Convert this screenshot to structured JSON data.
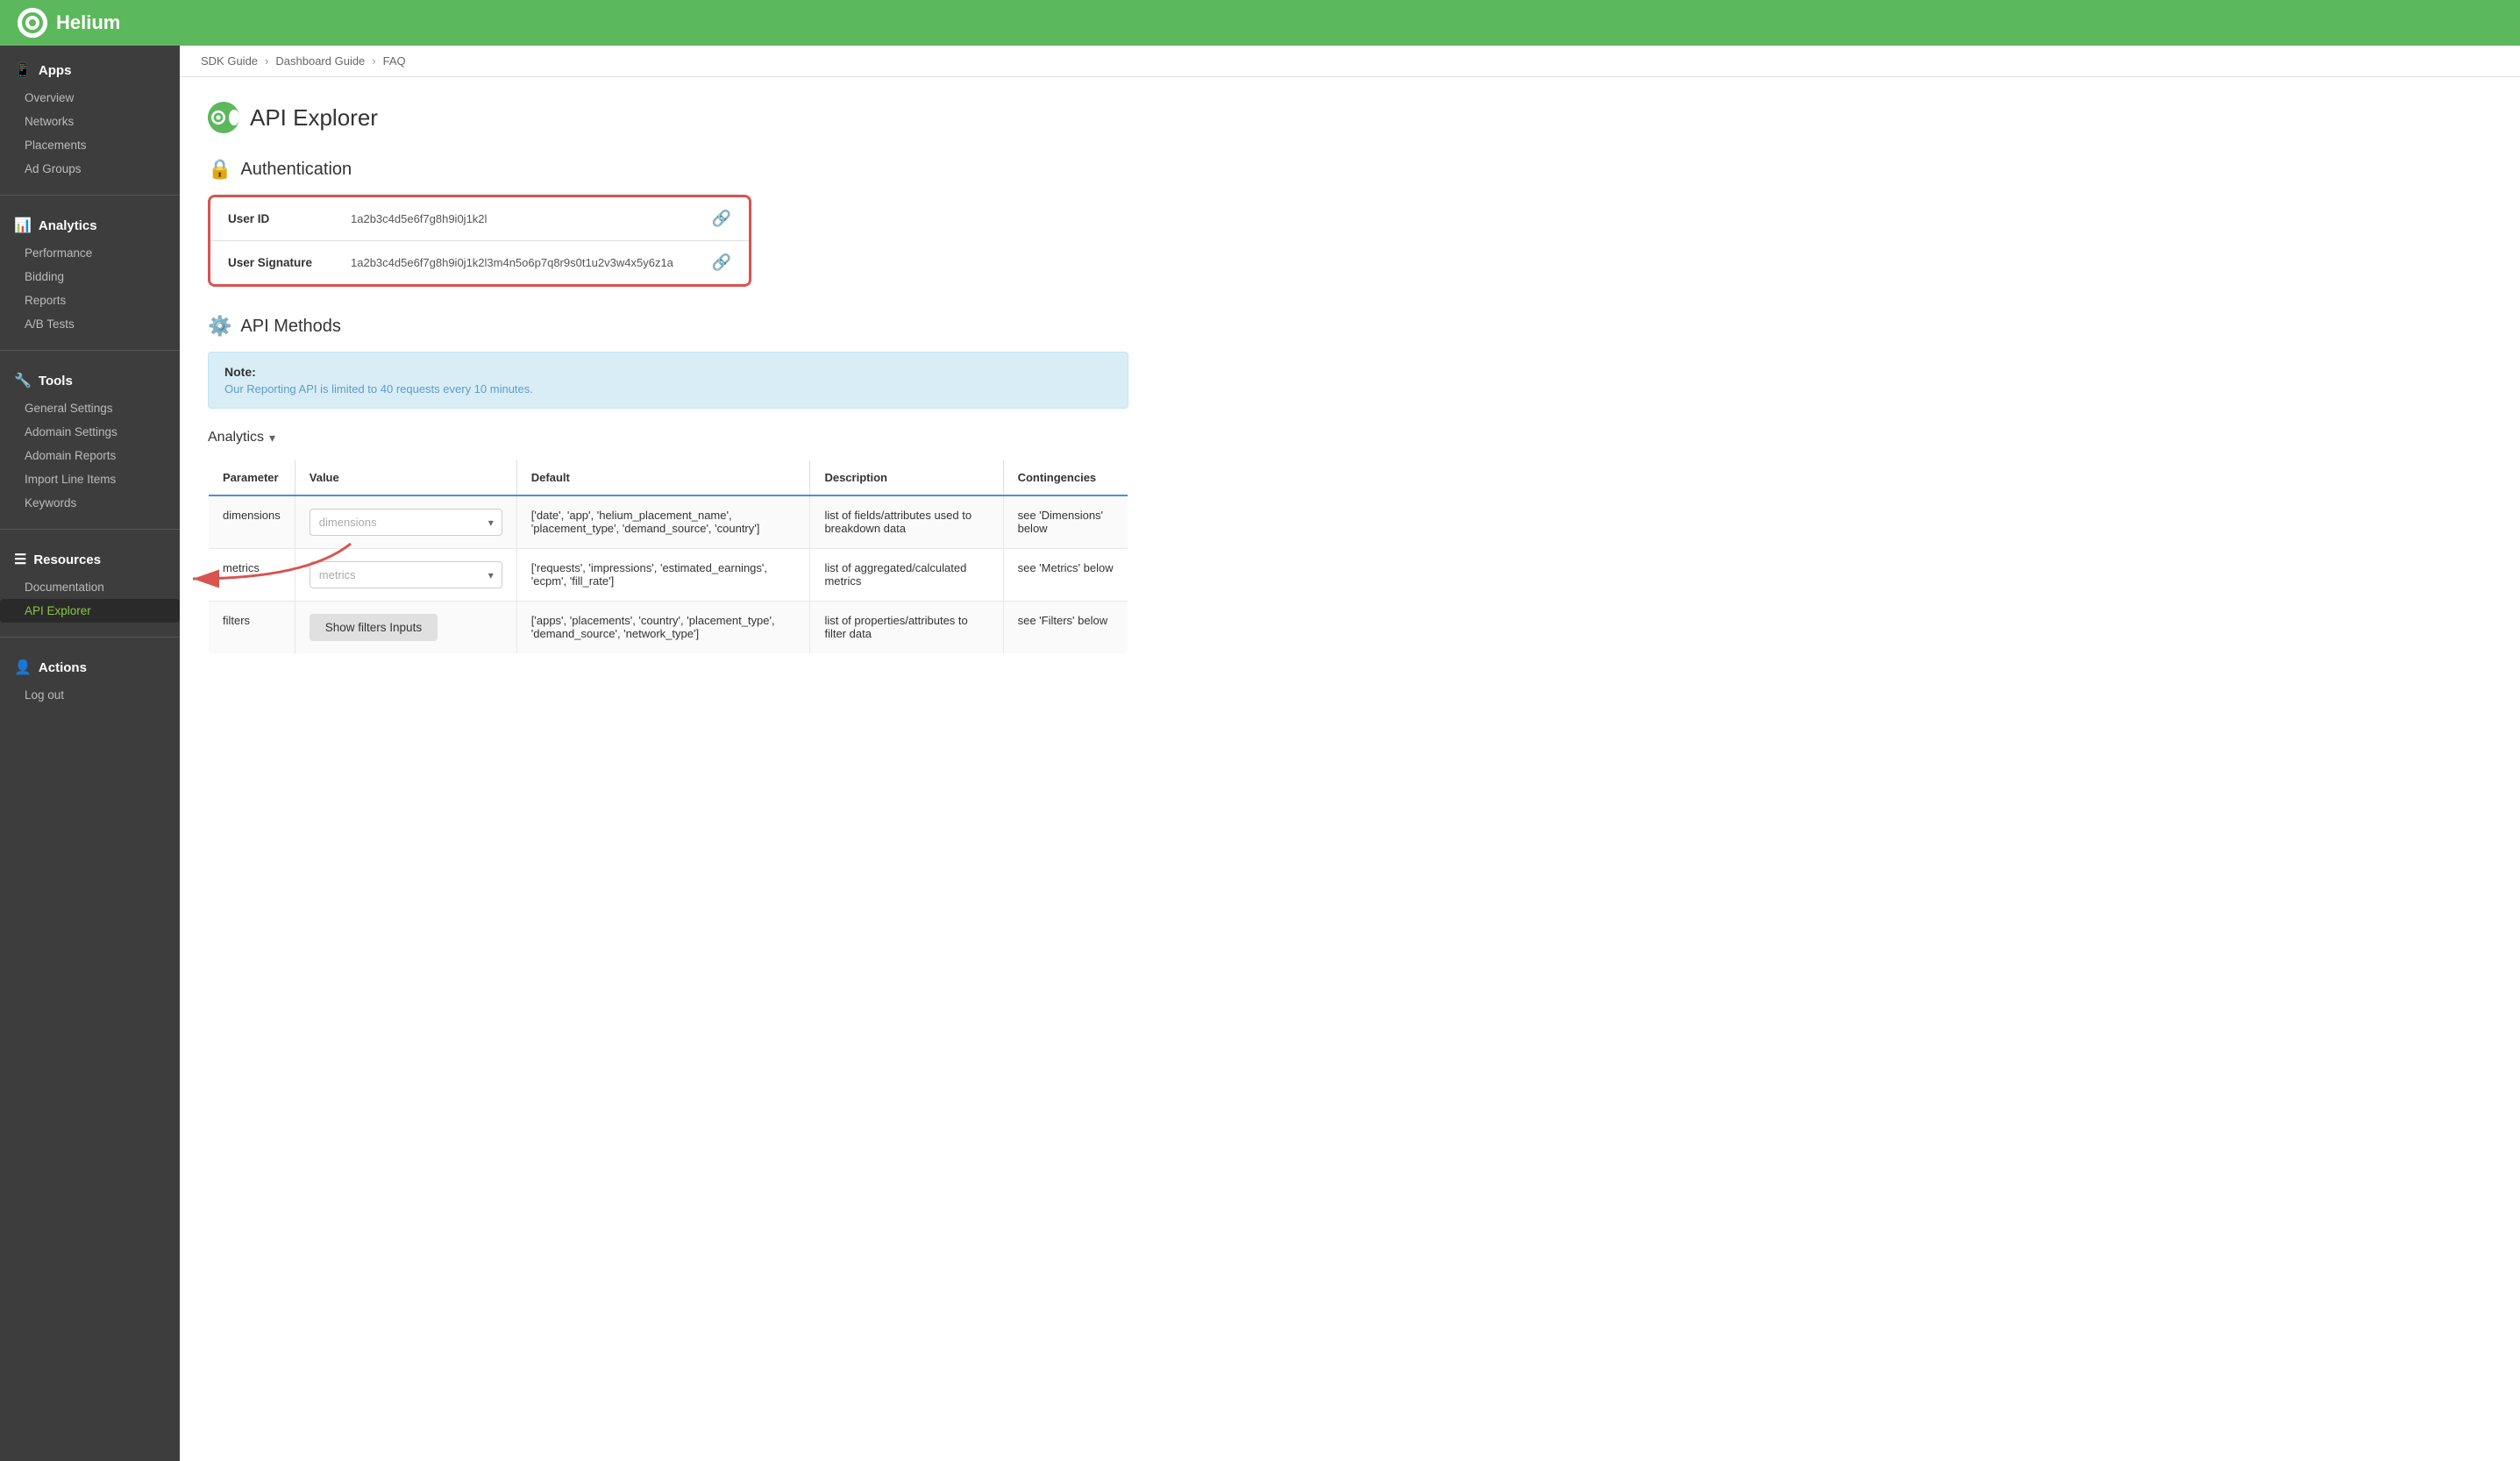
{
  "app": {
    "name": "Helium"
  },
  "breadcrumb": {
    "items": [
      "SDK Guide",
      "Dashboard Guide",
      "FAQ"
    ],
    "separators": [
      "›",
      "›"
    ]
  },
  "sidebar": {
    "sections": [
      {
        "id": "apps",
        "label": "Apps",
        "icon": "📱",
        "items": [
          "Overview",
          "Networks",
          "Placements",
          "Ad Groups"
        ]
      },
      {
        "id": "analytics",
        "label": "Analytics",
        "icon": "📊",
        "items": [
          "Performance",
          "Bidding",
          "Reports",
          "A/B Tests"
        ]
      },
      {
        "id": "tools",
        "label": "Tools",
        "icon": "🔧",
        "items": [
          "General Settings",
          "Adomain Settings",
          "Adomain Reports",
          "Import Line Items",
          "Keywords"
        ]
      },
      {
        "id": "resources",
        "label": "Resources",
        "icon": "☰",
        "items": [
          "Documentation",
          "API Explorer"
        ]
      },
      {
        "id": "actions",
        "label": "Actions",
        "icon": "👤",
        "items": [
          "Log out"
        ]
      }
    ]
  },
  "page": {
    "title": "API Explorer",
    "icon_label": "api-explorer-icon"
  },
  "authentication": {
    "section_title": "Authentication",
    "fields": [
      {
        "label": "User ID",
        "value": "1a2b3c4d5e6f7g8h9i0j1k2l"
      },
      {
        "label": "User Signature",
        "value": "1a2b3c4d5e6f7g8h9i0j1k2l3m4n5o6p7q8r9s0t1u2v3w4x5y6z1a"
      }
    ]
  },
  "api_methods": {
    "section_title": "API Methods",
    "note": {
      "title": "Note:",
      "text": "Our Reporting API is limited to 40 requests every 10 minutes."
    },
    "analytics_section": {
      "label": "Analytics",
      "chevron": "▾"
    },
    "table": {
      "headers": [
        "Parameter",
        "Value",
        "Default",
        "Description",
        "Contingencies"
      ],
      "rows": [
        {
          "parameter": "dimensions",
          "value_type": "select",
          "value_placeholder": "dimensions",
          "default": "['date', 'app', 'helium_placement_name', 'placement_type', 'demand_source', 'country']",
          "description": "list of fields/attributes used to breakdown data",
          "contingencies": "see 'Dimensions' below"
        },
        {
          "parameter": "metrics",
          "value_type": "select",
          "value_placeholder": "metrics",
          "default": "['requests', 'impressions', 'estimated_earnings', 'ecpm', 'fill_rate']",
          "description": "list of aggregated/calculated metrics",
          "contingencies": "see 'Metrics' below"
        },
        {
          "parameter": "filters",
          "value_type": "button",
          "value_label": "Show filters Inputs",
          "default": "['apps', 'placements', 'country', 'placement_type', 'demand_source', 'network_type']",
          "description": "list of properties/attributes to filter data",
          "contingencies": "see 'Filters' below"
        }
      ]
    }
  }
}
